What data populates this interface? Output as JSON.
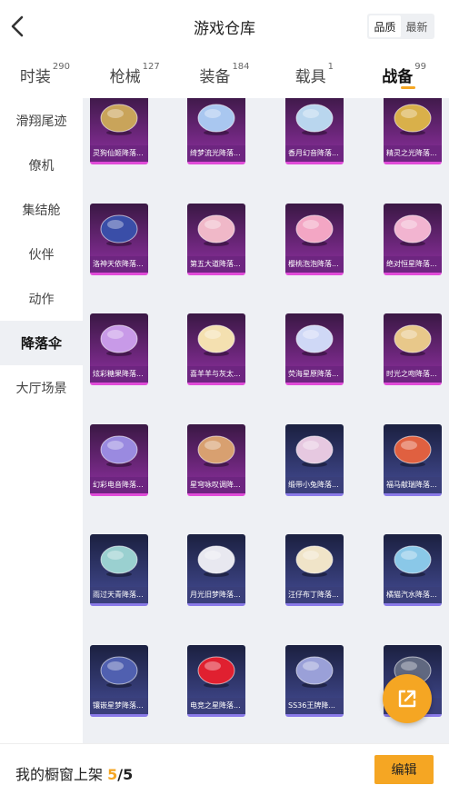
{
  "header": {
    "title": "游戏仓库",
    "sort_quality": "品质",
    "sort_latest": "最新"
  },
  "tabs": [
    {
      "label": "时装",
      "count": "290"
    },
    {
      "label": "枪械",
      "count": "127"
    },
    {
      "label": "装备",
      "count": "184"
    },
    {
      "label": "载具",
      "count": "1"
    },
    {
      "label": "战备",
      "count": "99"
    }
  ],
  "sidebar": {
    "items": [
      {
        "label": "滑翔尾迹"
      },
      {
        "label": "僚机"
      },
      {
        "label": "集结舱"
      },
      {
        "label": "伙伴"
      },
      {
        "label": "动作"
      },
      {
        "label": "降落伞"
      },
      {
        "label": "大厅场景"
      }
    ]
  },
  "items": [
    {
      "name": "灵狗仙姬降落...",
      "rarity": "epic",
      "color": "#c9a45a"
    },
    {
      "name": "绮梦流光降落...",
      "rarity": "epic",
      "color": "#a9c7f0"
    },
    {
      "name": "香月幻音降落...",
      "rarity": "epic",
      "color": "#b9d6ee"
    },
    {
      "name": "精灵之光降落...",
      "rarity": "epic",
      "color": "#d9b04a"
    },
    {
      "name": "洛神天依降落...",
      "rarity": "epic",
      "color": "#3a4ea8"
    },
    {
      "name": "第五大道降落...",
      "rarity": "epic",
      "color": "#f0b8c8"
    },
    {
      "name": "樱桃泡泡降落...",
      "rarity": "epic",
      "color": "#f3a6c4"
    },
    {
      "name": "绝对恒星降落...",
      "rarity": "epic",
      "color": "#f2b4d0"
    },
    {
      "name": "炫彩糖果降落...",
      "rarity": "epic",
      "color": "#c89ae8"
    },
    {
      "name": "喜羊羊与灰太...",
      "rarity": "epic",
      "color": "#f4e0b0"
    },
    {
      "name": "荧海星原降落...",
      "rarity": "epic",
      "color": "#cfd8f6"
    },
    {
      "name": "时光之吻降落...",
      "rarity": "epic",
      "color": "#e8c88a"
    },
    {
      "name": "幻彩电音降落...",
      "rarity": "epic",
      "color": "#9a8ae0"
    },
    {
      "name": "星穹咏叹调降...",
      "rarity": "epic",
      "color": "#d8a070"
    },
    {
      "name": "缎带小兔降落...",
      "rarity": "rare",
      "color": "#e6c8e0"
    },
    {
      "name": "福马献瑞降落...",
      "rarity": "rare",
      "color": "#e06040"
    },
    {
      "name": "雨过天青降落...",
      "rarity": "rare",
      "color": "#9ad0d0"
    },
    {
      "name": "月光旧梦降落...",
      "rarity": "rare",
      "color": "#e8e8f0"
    },
    {
      "name": "汪仔布丁降落...",
      "rarity": "rare",
      "color": "#f0e4c8"
    },
    {
      "name": "橘猫汽水降落...",
      "rarity": "rare",
      "color": "#8ac8e8"
    },
    {
      "name": "镶嵌星梦降落...",
      "rarity": "rare",
      "color": "#5060b0"
    },
    {
      "name": "电竞之星降落...",
      "rarity": "rare",
      "color": "#e02030"
    },
    {
      "name": "SS36王牌降...",
      "rarity": "rare",
      "color": "#9aa0d8"
    },
    {
      "name": "",
      "rarity": "rare",
      "color": "#606880"
    }
  ],
  "footer": {
    "label": "我的橱窗上架",
    "shown": "5",
    "total": "/5",
    "edit_label": "编辑"
  },
  "fab": {
    "icon": "share-icon"
  },
  "colors": {
    "accent": "#f5a623",
    "epic": "#e04bd8",
    "rare": "#8a7ae8"
  }
}
